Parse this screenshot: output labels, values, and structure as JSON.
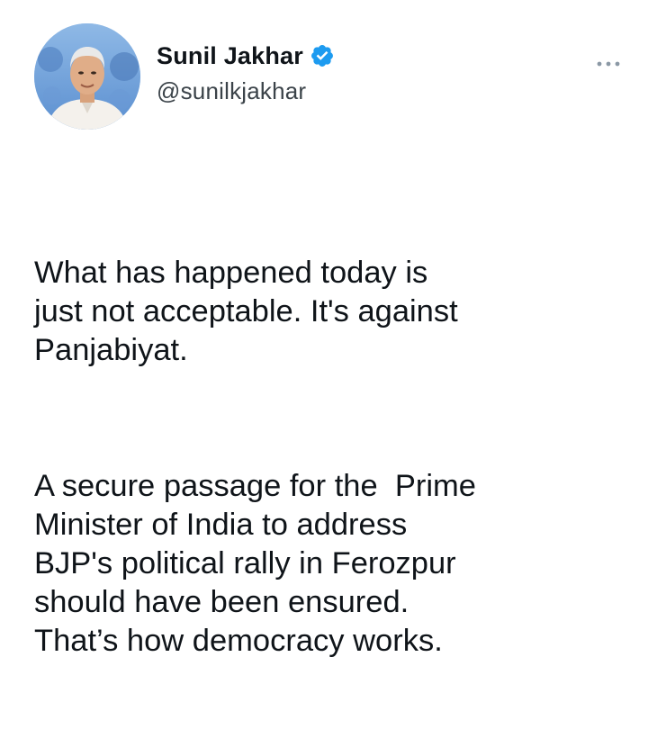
{
  "tweet": {
    "author": {
      "display_name": "Sunil Jakhar",
      "handle": "@sunilkjakhar",
      "verified": true
    },
    "icons": {
      "avatar": "profile-photo",
      "verified": "verified-badge-icon",
      "more": "more-options-icon"
    },
    "colors": {
      "verified_badge": "#1d9bf0",
      "text": "#0f1419",
      "handle": "#536471",
      "more_icon": "#8b98a5"
    },
    "paragraphs": [
      "What has happened today is\njust not acceptable. It's against\nPanjabiyat.",
      "A secure passage for the  Prime\nMinister of India to address\nBJP's political rally in Ferozpur\nshould have been ensured.\nThat’s how democracy works."
    ]
  }
}
